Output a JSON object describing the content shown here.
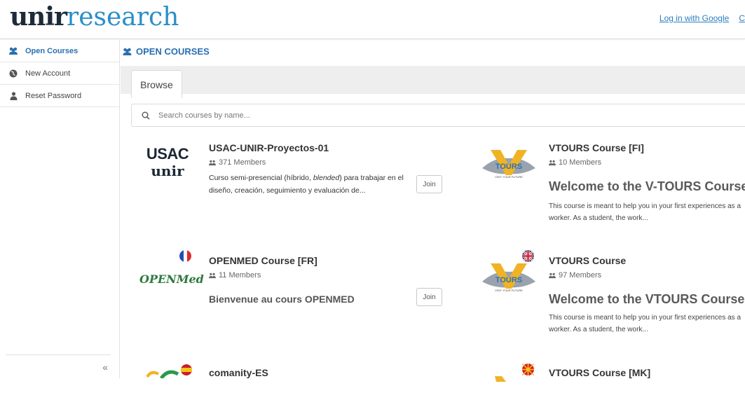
{
  "header": {
    "logo_brand": "unir",
    "logo_sub": "research",
    "login_google": "Log in with Google",
    "login_other": "C"
  },
  "sidebar": {
    "items": [
      {
        "label": "Open Courses",
        "icon": "users-icon"
      },
      {
        "label": "New Account",
        "icon": "globe-icon"
      },
      {
        "label": "Reset Password",
        "icon": "user-icon"
      }
    ],
    "collapse_glyph": "«"
  },
  "main": {
    "title": "OPEN COURSES",
    "tab_label": "Browse",
    "search_placeholder": "Search courses by name..."
  },
  "courses": [
    {
      "title": "USAC-UNIR-Proyectos-01",
      "members": "371 Members",
      "logo_line1": "USAC",
      "logo_line2": "unir",
      "description_pre": "Curso semi-presencial (híbrido, ",
      "description_em": "blended",
      "description_post": ") para trabajar en el diseño, creación, seguimiento y evaluación de...",
      "join_label": "Join"
    },
    {
      "title": "VTOURS Course [FI]",
      "members": "10 Members",
      "heading": "Welcome to the V-TOURS Course",
      "description": "This course is meant to help you in your first experiences as a worker. As a student, the work...",
      "logo_text": "TOURS",
      "logo_tagline": "VISIT YOUR FUTURE"
    },
    {
      "title": "OPENMED Course [FR]",
      "members": "11 Members",
      "heading": "Bienvenue au cours OPENMED",
      "logo_text": "OPENMed",
      "join_label": "Join"
    },
    {
      "title": "VTOURS Course",
      "members": "97 Members",
      "heading": "Welcome to the VTOURS Course",
      "description": "This course is meant to help you in your first experiences as a worker. As a student, the work...",
      "logo_text": "TOURS",
      "logo_tagline": "VISIT YOUR FUTURE"
    },
    {
      "title": "comanity-ES"
    },
    {
      "title": "VTOURS Course [MK]"
    }
  ],
  "colors": {
    "accent": "#2a6fb0",
    "link": "#2a7fc0",
    "logo_blue": "#2a8ec8",
    "vtours_gold": "#f0b323",
    "vtours_blue": "#2e6fb8"
  }
}
